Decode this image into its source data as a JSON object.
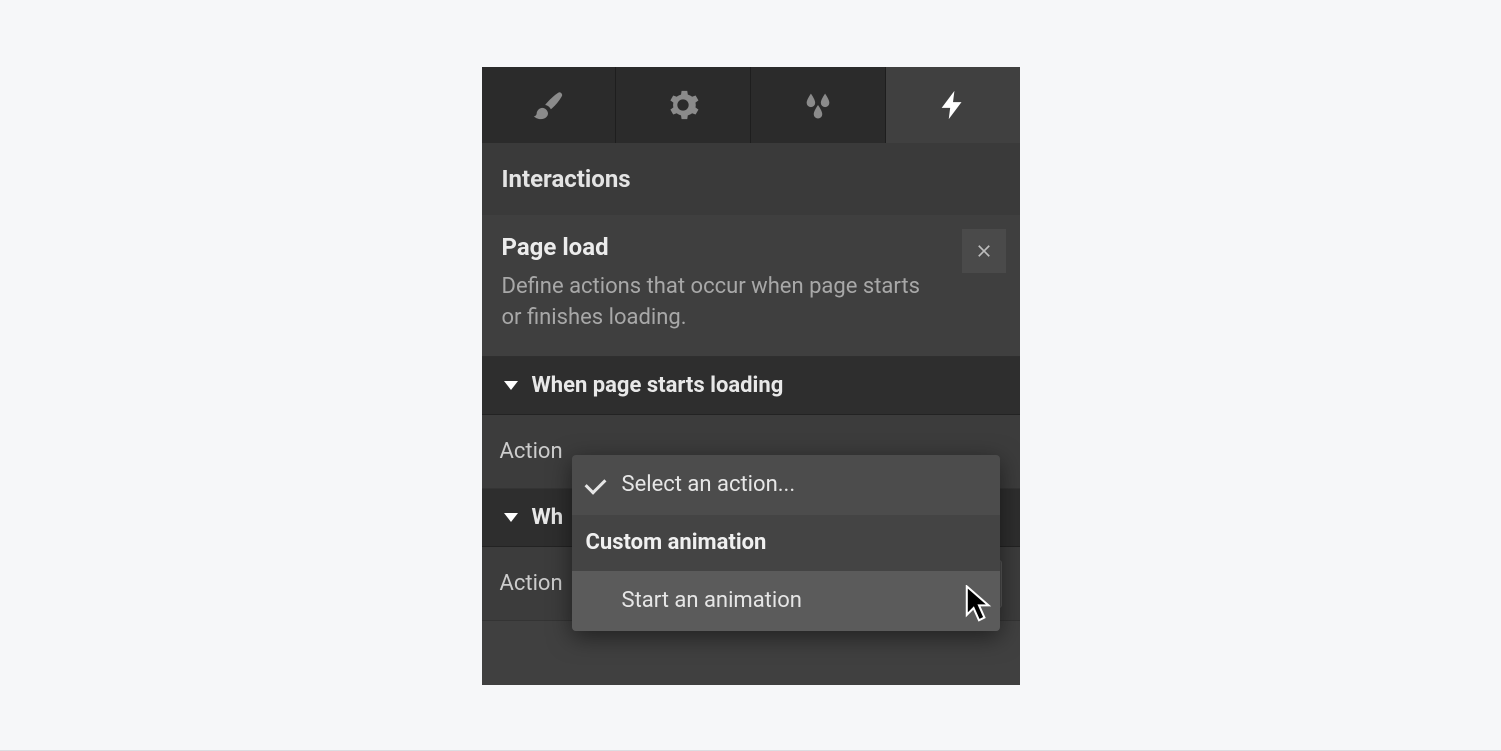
{
  "panel": {
    "title": "Interactions"
  },
  "trigger": {
    "title": "Page load",
    "description": "Define actions that occur when page starts or finishes loading."
  },
  "sections": [
    {
      "header": "When page starts loading",
      "action_label": "Action"
    },
    {
      "header_partial": "Wh",
      "action_label": "Action",
      "select_placeholder": "Select an action..."
    }
  ],
  "dropdown": {
    "selected": "Select an action...",
    "group_heading": "Custom animation",
    "hover_item": "Start an animation"
  }
}
